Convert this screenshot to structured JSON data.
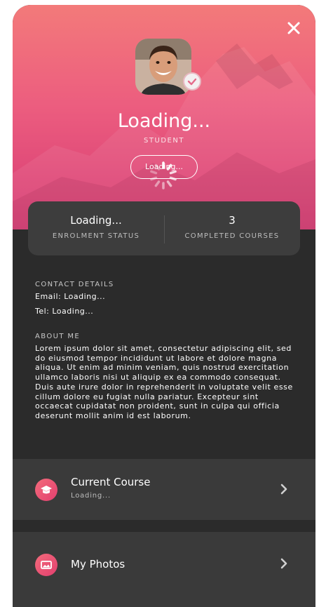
{
  "profile": {
    "name": "Loading...",
    "role": "STUDENT",
    "button_label": "Loading..."
  },
  "stats": {
    "enrolment_value": "Loading...",
    "enrolment_label": "ENROLMENT STATUS",
    "courses_value": "3",
    "courses_label": "COMPLETED COURSES"
  },
  "contact": {
    "title": "CONTACT DETAILS",
    "email": "Email: Loading...",
    "tel": "Tel: Loading..."
  },
  "about": {
    "title": "ABOUT ME",
    "text": "Lorem ipsum dolor sit amet, consectetur adipiscing elit, sed do eiusmod tempor incididunt ut labore et dolore magna aliqua. Ut enim ad minim veniam, quis nostrud exercitation ullamco laboris nisi ut aliquip ex ea commodo consequat. Duis aute irure dolor in reprehenderit in voluptate velit esse cillum dolore eu fugiat nulla pariatur. Excepteur sint occaecat cupidatat non proident, sunt in culpa qui officia deserunt mollit anim id est laborum."
  },
  "menu": {
    "current_course": {
      "title": "Current Course",
      "subtitle": "Loading...",
      "icon": "graduation-cap-icon"
    },
    "photos": {
      "title": "My Photos",
      "icon": "photos-icon"
    }
  },
  "colors": {
    "accent_top": "#f37a7a",
    "accent_bottom": "#d63a73",
    "panel": "#2b2b2b",
    "row": "#3a3a3a"
  }
}
